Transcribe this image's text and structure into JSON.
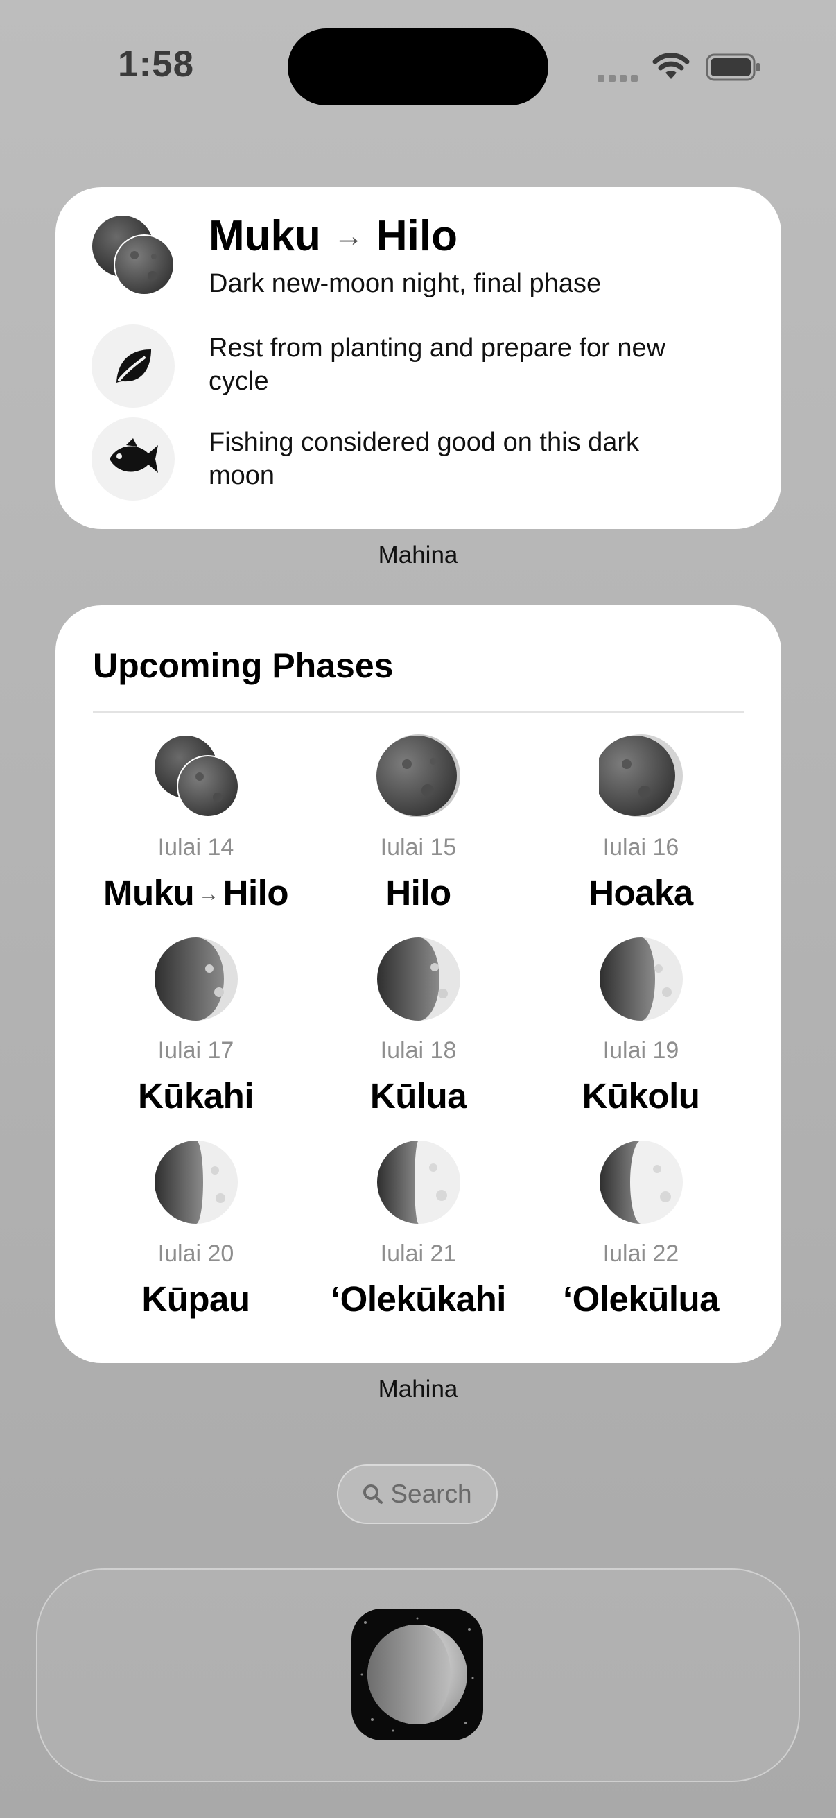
{
  "status_bar": {
    "time": "1:58"
  },
  "today_widget": {
    "title_from": "Muku",
    "title_to": "Hilo",
    "subtitle": "Dark new-moon night, final phase",
    "planting_note": "Rest from planting and prepare for new cycle",
    "fishing_note": "Fishing considered good on this dark moon",
    "caption": "Mahina"
  },
  "phases_widget": {
    "title": "Upcoming Phases",
    "caption": "Mahina",
    "items": [
      {
        "date": "Iulai 14",
        "name_from": "Muku",
        "name_to": "Hilo"
      },
      {
        "date": "Iulai 15",
        "name": "Hilo"
      },
      {
        "date": "Iulai 16",
        "name": "Hoaka"
      },
      {
        "date": "Iulai 17",
        "name": "Kūkahi"
      },
      {
        "date": "Iulai 18",
        "name": "Kūlua"
      },
      {
        "date": "Iulai 19",
        "name": "Kūkolu"
      },
      {
        "date": "Iulai 20",
        "name": "Kūpau"
      },
      {
        "date": "Iulai 21",
        "name": "ʻOlekūkahi"
      },
      {
        "date": "Iulai 22",
        "name": "ʻOlekūlua"
      }
    ]
  },
  "search": {
    "label": "Search"
  },
  "dock": {
    "app_icon": "moon-app-icon"
  },
  "icons": {
    "planting": "leaf-icon",
    "fishing": "fish-icon"
  }
}
